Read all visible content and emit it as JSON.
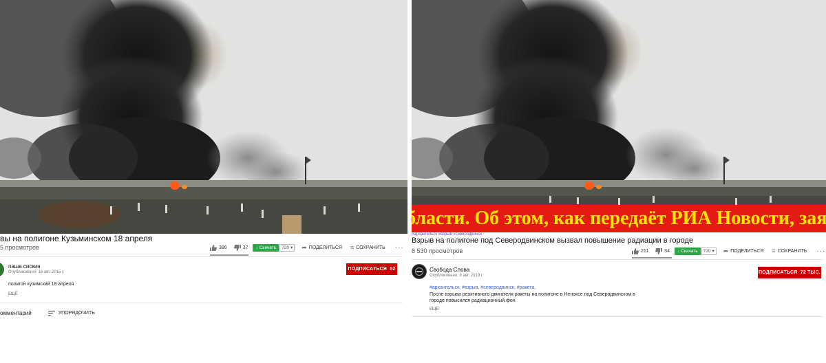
{
  "left": {
    "title": "вы на полигоне Кузьминском 18 апреля",
    "views": "5 просмотров",
    "likes": "386",
    "dislikes": "37",
    "download_label": "Скачать",
    "quality": "720",
    "share_label": "ПОДЕЛИТЬСЯ",
    "save_label": "СОХРАНИТЬ",
    "more_dots": "···",
    "channel_name": "паша сискин",
    "published": "Опубликовано: 16 авг. 2015 г.",
    "subscribe_label": "ПОДПИСАТЬСЯ",
    "subscribe_count": "52",
    "description": "полигон кузимский 18 апреля",
    "more_label": "ЕЩЁ",
    "comments_label": "омментарий",
    "sort_label": "УПОРЯДОЧИТЬ"
  },
  "right": {
    "ticker_text": "бласти. Об этом, как передаёт РИА Новости, заяв",
    "small_hashtags": "#архангельск #взрыв #северодвинск",
    "title": "Взрыв на полигоне под Северодвинском вызвал повышение радиации в городе",
    "views": "8 530 просмотров",
    "likes": "211",
    "dislikes": "34",
    "download_label": "Скачать",
    "quality": "720",
    "share_label": "ПОДЕЛИТЬСЯ",
    "save_label": "СОХРАНИТЬ",
    "more_dots": "···",
    "channel_name": "Свобода Слова",
    "published": "Опубликовано: 9 авг. 2019 г.",
    "subscribe_label": "ПОДПИСАТЬСЯ",
    "subscribe_count": "72 ТЫС.",
    "hashtags": "#архангельск, #взрыв, #северодвинск, #ракета,",
    "description_line1": "После взрыва реактивного двигателя ракеты на полигоне в Неноксе под Северодвинском в",
    "description_line2": "городе повысился радиационный фон.",
    "more_label": "ЕЩЁ"
  },
  "colors": {
    "subscribe_red": "#cc0000",
    "download_green": "#2fa54a",
    "ticker_red": "#e41b13",
    "ticker_yellow": "#ffe400",
    "hashtag_blue": "#3a5fc8"
  }
}
